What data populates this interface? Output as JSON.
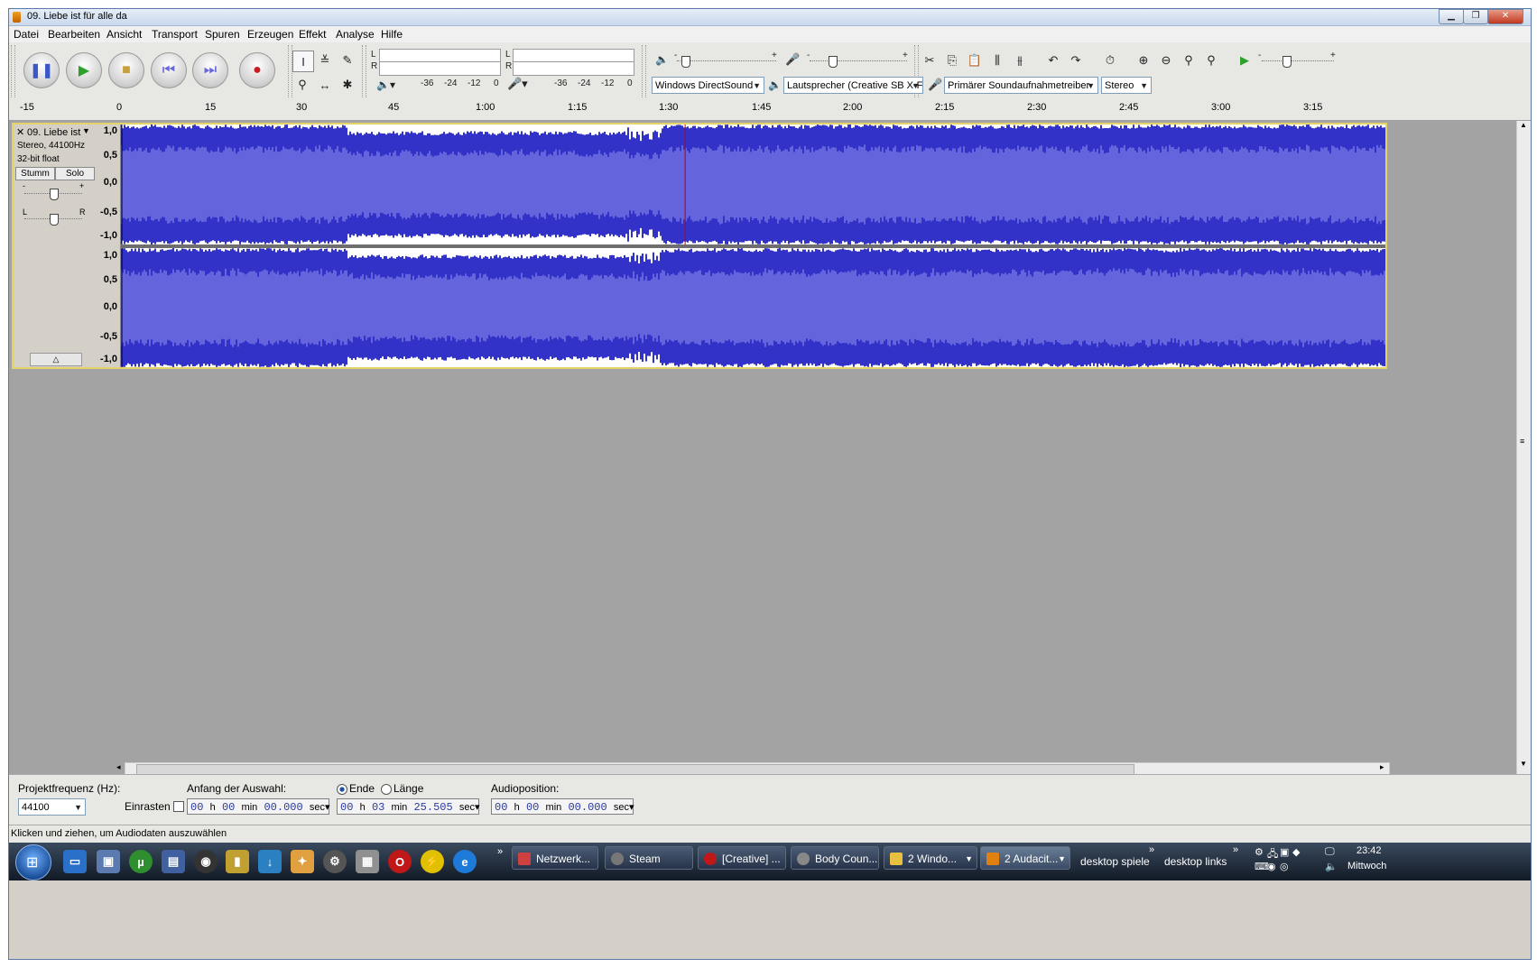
{
  "window": {
    "title": "09. Liebe ist für alle da"
  },
  "menu": [
    "Datei",
    "Bearbeiten",
    "Ansicht",
    "Transport",
    "Spuren",
    "Erzeugen",
    "Effekt",
    "Analyse",
    "Hilfe"
  ],
  "meters": {
    "playback_ticks": [
      "-36",
      "-24",
      "-12",
      "0"
    ],
    "record_ticks": [
      "-36",
      "-24",
      "-12",
      "0"
    ],
    "lr": [
      "L",
      "R"
    ]
  },
  "slider_signs": {
    "minus": "-",
    "plus": "+"
  },
  "devices": {
    "host": "Windows DirectSound",
    "output": "Lautsprecher (Creative SB X-F",
    "input": "Primärer Soundaufnahmetreiber",
    "channels": "Stereo"
  },
  "ruler": {
    "labels": [
      "-15",
      "0",
      "15",
      "30",
      "45",
      "1:00",
      "1:15",
      "1:30",
      "1:45",
      "2:00",
      "2:15",
      "2:30",
      "2:45",
      "3:00",
      "3:15"
    ]
  },
  "track": {
    "name": "09. Liebe ist",
    "info1": "Stereo, 44100Hz",
    "info2": "32-bit float",
    "mute": "Stumm",
    "solo": "Solo",
    "gain_minus": "-",
    "gain_plus": "+",
    "pan_left": "L",
    "pan_right": "R",
    "scale": [
      "1,0",
      "0,5",
      "0,0",
      "-0,5",
      "-1,0"
    ],
    "wave_color": "#3232c8",
    "rms_color": "#6464dc",
    "cursor_color": "#c00000",
    "cursor_time": "1:32"
  },
  "selection": {
    "project_rate_label": "Projektfrequenz (Hz):",
    "project_rate": "44100",
    "snap_label": "Einrasten",
    "start_label": "Anfang der Auswahl:",
    "start_time": {
      "h": "00",
      "m": "00",
      "s": "00.000"
    },
    "end_label": "Ende",
    "length_label": "Länge",
    "end_time": {
      "h": "00",
      "m": "03",
      "s": "25.505"
    },
    "audio_pos_label": "Audioposition:",
    "audio_pos": {
      "h": "00",
      "m": "00",
      "s": "00.000"
    },
    "unit_h": "h",
    "unit_m": "min",
    "unit_s": "sec"
  },
  "status": "Klicken und ziehen, um Audiodaten auszuwählen",
  "taskbar": {
    "tasks": [
      "Netzwerk...",
      "Steam",
      "[Creative] ...",
      "Body Coun...",
      "2 Windo...",
      "2 Audacit..."
    ],
    "toolbars": [
      "desktop spiele",
      "desktop links"
    ],
    "chevron": "»",
    "clock": "23:42",
    "day": "Mittwoch"
  }
}
